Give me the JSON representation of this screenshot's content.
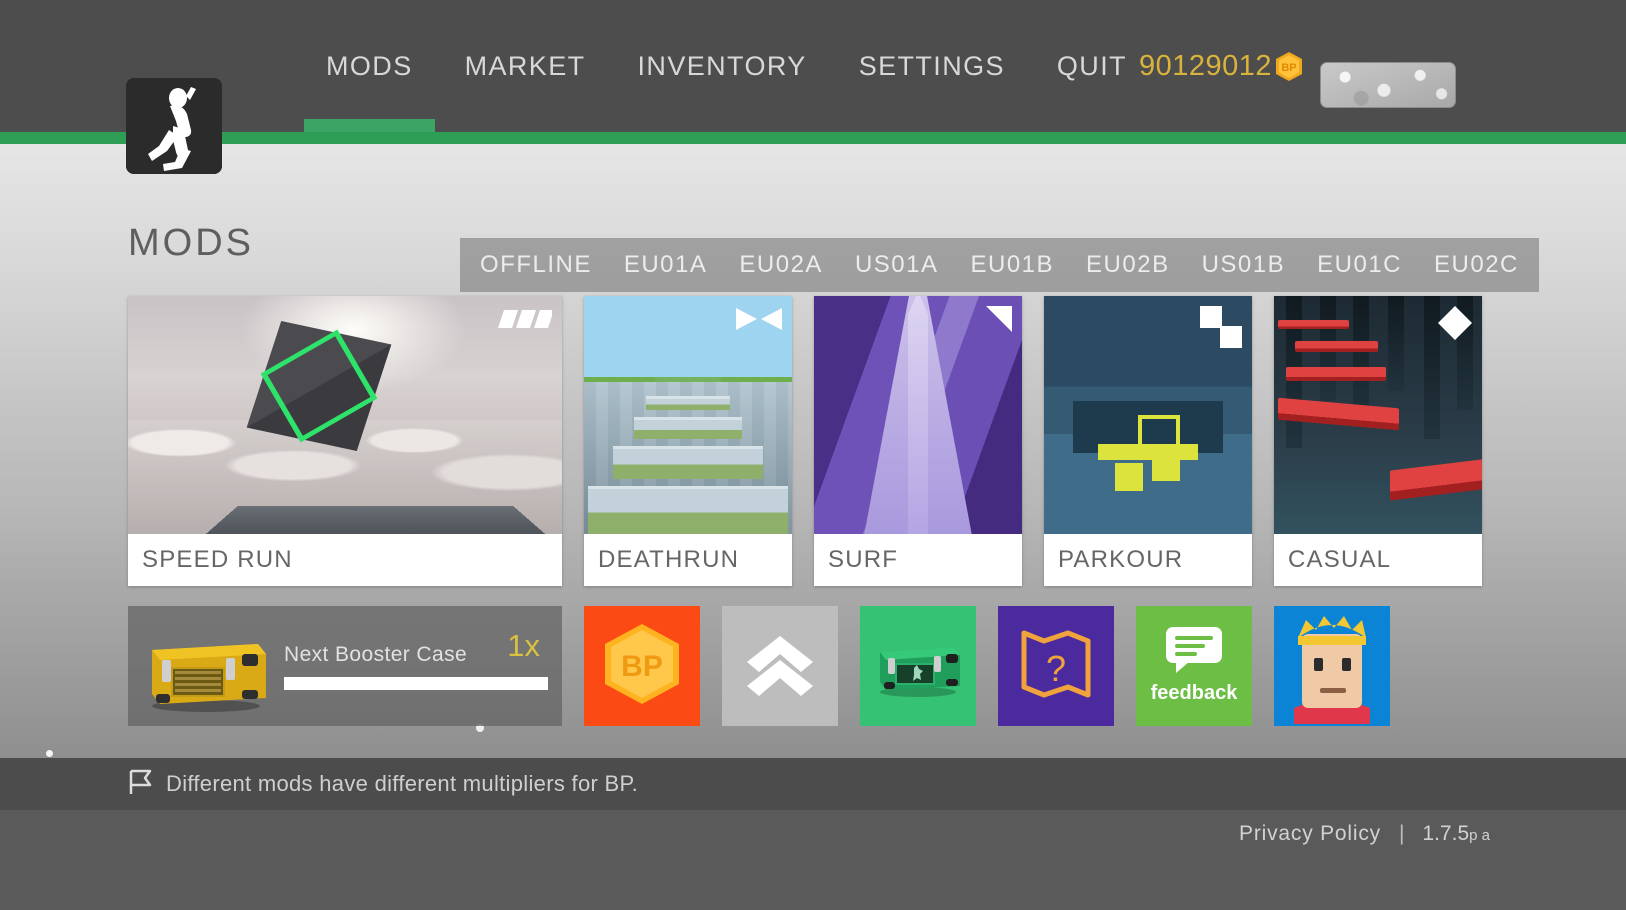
{
  "header": {
    "logo_icon": "running-man-icon",
    "nav": [
      {
        "label": "MODS",
        "active": true
      },
      {
        "label": "MARKET",
        "active": false
      },
      {
        "label": "INVENTORY",
        "active": false
      },
      {
        "label": "SETTINGS",
        "active": false
      },
      {
        "label": "QUIT",
        "active": false
      }
    ],
    "currency": {
      "amount": "90129012",
      "icon": "bp-hex-icon",
      "icon_label": "BP",
      "color": "#d9b33c"
    },
    "avatar_chip_icon": "avatar-chip-icon",
    "accent_color": "#2e9e57"
  },
  "main": {
    "title": "MODS",
    "server_tabs": [
      "OFFLINE",
      "EU01A",
      "EU02A",
      "US01A",
      "EU01B",
      "EU02B",
      "US01B",
      "EU01C",
      "EU02C"
    ],
    "mods": [
      {
        "name": "SPEED RUN",
        "badge_icon": "speed-bars-icon",
        "size": "wide"
      },
      {
        "name": "DEATHRUN",
        "badge_icon": "bowtie-icon",
        "size": "square"
      },
      {
        "name": "SURF",
        "badge_icon": "triangle-icon",
        "size": "square"
      },
      {
        "name": "PARKOUR",
        "badge_icon": "two-squares-icon",
        "size": "square"
      },
      {
        "name": "CASUAL",
        "badge_icon": "diamond-icon",
        "size": "square"
      }
    ],
    "booster": {
      "icon": "yellow-case-icon",
      "label": "Next Booster Case",
      "multiplier": "1x",
      "progress_percent": 100,
      "multiplier_color": "#d7c13f"
    },
    "tiles": [
      {
        "name": "buy-bp",
        "icon": "bp-hex-icon",
        "label": "",
        "color": "#fc4a14"
      },
      {
        "name": "upgrade",
        "icon": "double-chevron-up-icon",
        "label": "",
        "color": "#bdbdbd"
      },
      {
        "name": "green-case",
        "icon": "green-case-icon",
        "label": "",
        "color": "#36c274"
      },
      {
        "name": "map-quest",
        "icon": "map-question-icon",
        "label": "",
        "color": "#4b2a9e"
      },
      {
        "name": "feedback",
        "icon": "speech-bubble-icon",
        "label": "feedback",
        "color": "#6cbe45"
      },
      {
        "name": "character",
        "icon": "character-avatar-icon",
        "label": "",
        "color": "#0b84d6"
      }
    ]
  },
  "footer": {
    "tip_icon": "flag-icon",
    "tip_text": "Different mods have different multipliers for BP.",
    "privacy_label": "Privacy Policy",
    "separator": "|",
    "version": "1.7.5",
    "version_suffix": "p a"
  }
}
